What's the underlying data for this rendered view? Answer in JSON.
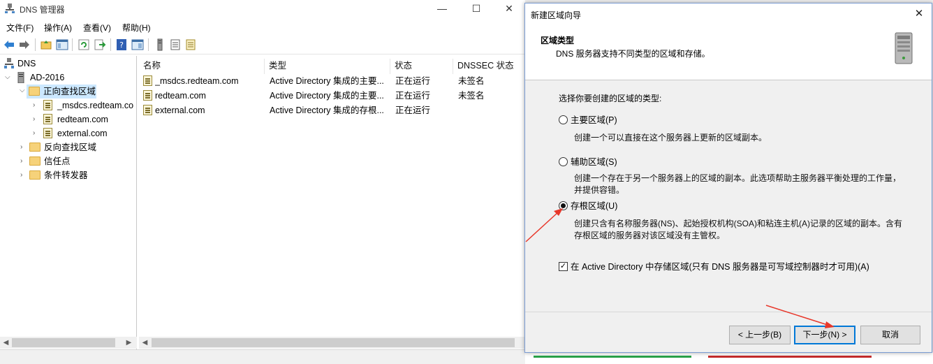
{
  "app": {
    "title": "DNS 管理器",
    "controls": {
      "minimize": "—",
      "maximize": "☐",
      "close": "✕"
    }
  },
  "menu": [
    "文件(F)",
    "操作(A)",
    "查看(V)",
    "帮助(H)"
  ],
  "toolbar_icons": [
    "back-icon",
    "forward-icon",
    "up-folder-icon",
    "show-tree-icon",
    "refresh-icon",
    "export-icon",
    "help-icon",
    "properties-icon",
    "server-icon",
    "list-icon",
    "zone-icon"
  ],
  "tree": {
    "root": "DNS",
    "server": "AD-2016",
    "forward_zone": "正向查找区域",
    "forward_children": [
      "_msdcs.redteam.co",
      "redteam.com",
      "external.com"
    ],
    "reverse_zone": "反向查找区域",
    "trust_points": "信任点",
    "conditional_forwarders": "条件转发器"
  },
  "list": {
    "columns": [
      "名称",
      "类型",
      "状态",
      "DNSSEC 状态"
    ],
    "rows": [
      {
        "name": "_msdcs.redteam.com",
        "type": "Active Directory 集成的主要...",
        "status": "正在运行",
        "dnssec": "未签名"
      },
      {
        "name": "redteam.com",
        "type": "Active Directory 集成的主要...",
        "status": "正在运行",
        "dnssec": "未签名"
      },
      {
        "name": "external.com",
        "type": "Active Directory 集成的存根...",
        "status": "正在运行",
        "dnssec": ""
      }
    ]
  },
  "wizard": {
    "title": "新建区域向导",
    "close": "✕",
    "heading": "区域类型",
    "subheading": "DNS 服务器支持不同类型的区域和存储。",
    "prompt": "选择你要创建的区域的类型:",
    "options": [
      {
        "label": "主要区域(P)",
        "desc": "创建一个可以直接在这个服务器上更新的区域副本。",
        "selected": false
      },
      {
        "label": "辅助区域(S)",
        "desc": "创建一个存在于另一个服务器上的区域的副本。此选项帮助主服务器平衡处理的工作量，并提供容错。",
        "selected": false
      },
      {
        "label": "存根区域(U)",
        "desc": "创建只含有名称服务器(NS)、起始授权机构(SOA)和粘连主机(A)记录的区域的副本。含有存根区域的服务器对该区域没有主管权。",
        "selected": true
      }
    ],
    "store_in_ad": {
      "label": "在 Active Directory 中存储区域(只有 DNS 服务器是可写域控制器时才可用)(A)",
      "checked": true
    },
    "buttons": {
      "back": "< 上一步(B)",
      "next": "下一步(N) >",
      "cancel": "取消"
    }
  },
  "colors": {
    "selection": "#cce8ff",
    "accent": "#0078d7",
    "annotation": "#e8372a"
  }
}
